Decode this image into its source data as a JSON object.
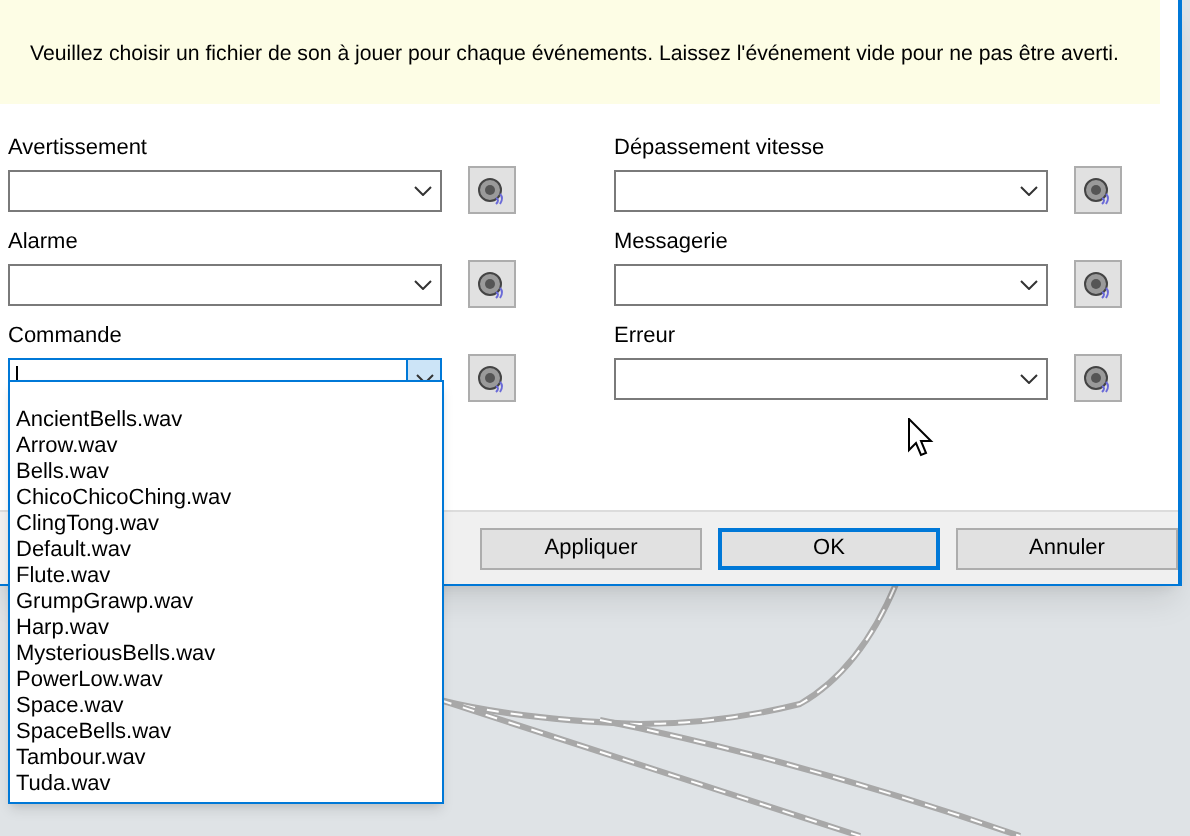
{
  "notice": "Veuillez choisir un fichier de son à jouer pour chaque événements. Laissez l'événement vide pour ne pas être averti.",
  "fields": [
    {
      "label": "Avertissement",
      "expanded": false
    },
    {
      "label": "Dépassement vitesse",
      "expanded": false
    },
    {
      "label": "Alarme",
      "expanded": false
    },
    {
      "label": "Messagerie",
      "expanded": false
    },
    {
      "label": "Commande",
      "expanded": true
    },
    {
      "label": "Erreur",
      "expanded": false
    }
  ],
  "options": [
    {
      "label": "AncientBells.wav",
      "selected": false
    },
    {
      "label": "Arrow.wav",
      "selected": false
    },
    {
      "label": "Bells.wav",
      "selected": false
    },
    {
      "label": "ChicoChicoChing.wav",
      "selected": false
    },
    {
      "label": "ClingTong.wav",
      "selected": false
    },
    {
      "label": "Default.wav",
      "selected": false
    },
    {
      "label": "Flute.wav",
      "selected": false
    },
    {
      "label": "GrumpGrawp.wav",
      "selected": false
    },
    {
      "label": "Harp.wav",
      "selected": false
    },
    {
      "label": "MysteriousBells.wav",
      "selected": false
    },
    {
      "label": "PowerLow.wav",
      "selected": false
    },
    {
      "label": "Space.wav",
      "selected": false
    },
    {
      "label": "SpaceBells.wav",
      "selected": false
    },
    {
      "label": "Tambour.wav",
      "selected": false
    },
    {
      "label": "Tuda.wav",
      "selected": false
    }
  ],
  "buttons": [
    {
      "label": "Appliquer",
      "selected": false
    },
    {
      "label": "OK",
      "selected": true
    },
    {
      "label": "Annuler",
      "selected": false
    }
  ]
}
